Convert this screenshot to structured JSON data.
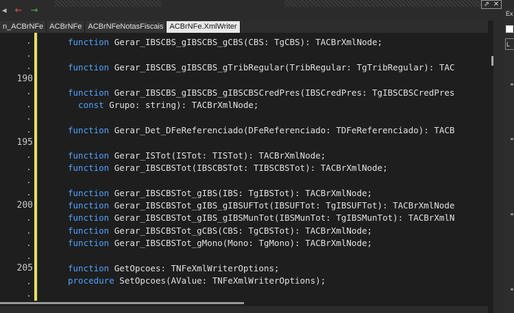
{
  "toolbar": {
    "back_arrow": "◂",
    "red_arrow": "←",
    "green_arrow": "→"
  },
  "window_buttons": {
    "pin": "⇗",
    "close": "✕"
  },
  "tabs": [
    {
      "label": "n_ACBrNFe",
      "active": false
    },
    {
      "label": "ACBrNFe",
      "active": false
    },
    {
      "label": "ACBrNFeNotasFiscais",
      "active": false
    },
    {
      "label": "ACBrNFe.XmlWriter",
      "active": true
    }
  ],
  "gutter": {
    "line_numbers": [
      "190",
      "195",
      "200",
      "205"
    ]
  },
  "code_lines": [
    {
      "keyword": "function",
      "text": " Gerar_IBSCBS_gIBSCBS_gCBS(CBS: TgCBS): TACBrXmlNode;"
    },
    {
      "keyword": "",
      "text": ""
    },
    {
      "keyword": "function",
      "text": " Gerar_IBSCBS_gIBSCBS_gTribRegular(TribRegular: TgTribRegular): TAC"
    },
    {
      "keyword": "",
      "text": ""
    },
    {
      "keyword": "function",
      "text": " Gerar_IBSCBS_gIBSCBS_gIBSCBSCredPres(IBSCredPres: TgIBSCBSCredPres"
    },
    {
      "keyword": "  const",
      "text": " Grupo: string): TACBrXmlNode;"
    },
    {
      "keyword": "",
      "text": ""
    },
    {
      "keyword": "function",
      "text": " Gerar_Det_DFeReferenciado(DFeReferenciado: TDFeReferenciado): TACB"
    },
    {
      "keyword": "",
      "text": ""
    },
    {
      "keyword": "function",
      "text": " Gerar_ISTot(ISTot: TISTot): TACBrXmlNode;"
    },
    {
      "keyword": "function",
      "text": " Gerar_IBSCBSTot(IBSCBSTot: TIBSCBSTot): TACBrXmlNode;"
    },
    {
      "keyword": "",
      "text": ""
    },
    {
      "keyword": "function",
      "text": " Gerar_IBSCBSTot_gIBS(IBS: TgIBSTot): TACBrXmlNode;"
    },
    {
      "keyword": "function",
      "text": " Gerar_IBSCBSTot_gIBS_gIBSUFTot(IBSUFTot: TgIBSUFTot): TACBrXmlNode"
    },
    {
      "keyword": "function",
      "text": " Gerar_IBSCBSTot_gIBS_gIBSMunTot(IBSMunTot: TgIBSMunTot): TACBrXmlN"
    },
    {
      "keyword": "function",
      "text": " Gerar_IBSCBSTot_gCBS(CBS: TgCBSTot): TACBrXmlNode;"
    },
    {
      "keyword": "function",
      "text": " Gerar_IBSCBSTot_gMono(Mono: TgMono): TACBrXmlNode;"
    },
    {
      "keyword": "",
      "text": ""
    },
    {
      "keyword": "function",
      "text": " GetOpcoes: TNFeXmlWriterOptions;"
    },
    {
      "keyword": "procedure",
      "text": " SetOpcoes(AValue: TNFeXmlWriterOptions);"
    }
  ],
  "right_panel": {
    "title": "Ex",
    "label": "L"
  },
  "colors": {
    "keyword": "#4fa3ff",
    "text": "#e0e0e0",
    "modified_bar": "#e8e060",
    "background": "#1e1e1e"
  }
}
